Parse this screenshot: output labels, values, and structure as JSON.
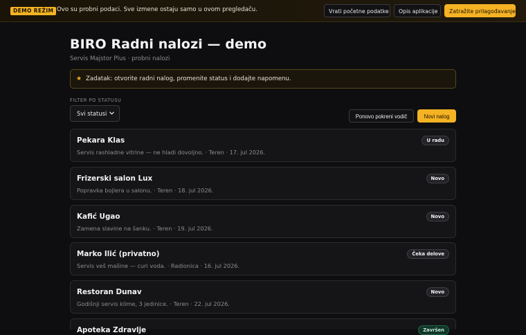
{
  "demo_bar": {
    "badge": "DEMO REŽIM",
    "message": "Ovo su probni podaci. Sve izmene ostaju samo u ovom pregledaču.",
    "reset_label": "Vrati početne podatke",
    "about_label": "Opis aplikacije",
    "custom_label": "Zatražite prilagođavanje"
  },
  "header": {
    "title": "BIRO Radni nalozi — demo",
    "subtitle": "Servis Majstor Plus · probni nalozi"
  },
  "task": {
    "icon": "star-icon",
    "text": "Zadatak: otvorite radni nalog, promenite status i dodajte napomenu."
  },
  "filter": {
    "label": "FILTER PO STATUSU",
    "selected": "Svi statusi"
  },
  "actions": {
    "restart_guide_label": "Ponovo pokreni vodič",
    "new_order_label": "Novi nalog"
  },
  "orders": [
    {
      "name": "Pekara Klas",
      "description": "Servis rashladne vitrine — ne hladi dovoljno. · Teren · 17. jul 2026.",
      "status": "U radu"
    },
    {
      "name": "Frizerski salon Lux",
      "description": "Popravka bojlera u salonu. · Teren · 18. jul 2026.",
      "status": "Novo"
    },
    {
      "name": "Kafić Ugao",
      "description": "Zamena slavine na šanku. · Teren · 19. jul 2026.",
      "status": "Novo"
    },
    {
      "name": "Marko Ilić (privatno)",
      "description": "Servis veš mašine — curi voda. · Radionica · 16. jul 2026.",
      "status": "Čeka delove"
    },
    {
      "name": "Restoran Dunav",
      "description": "Godišnji servis klime, 3 jedinice. · Teren · 22. jul 2026.",
      "status": "Novo"
    },
    {
      "name": "Apoteka Zdravlje",
      "description": "",
      "status": "Završen"
    }
  ],
  "colors": {
    "accent": "#f5b324",
    "background": "#0e0e10",
    "card": "#151517"
  }
}
